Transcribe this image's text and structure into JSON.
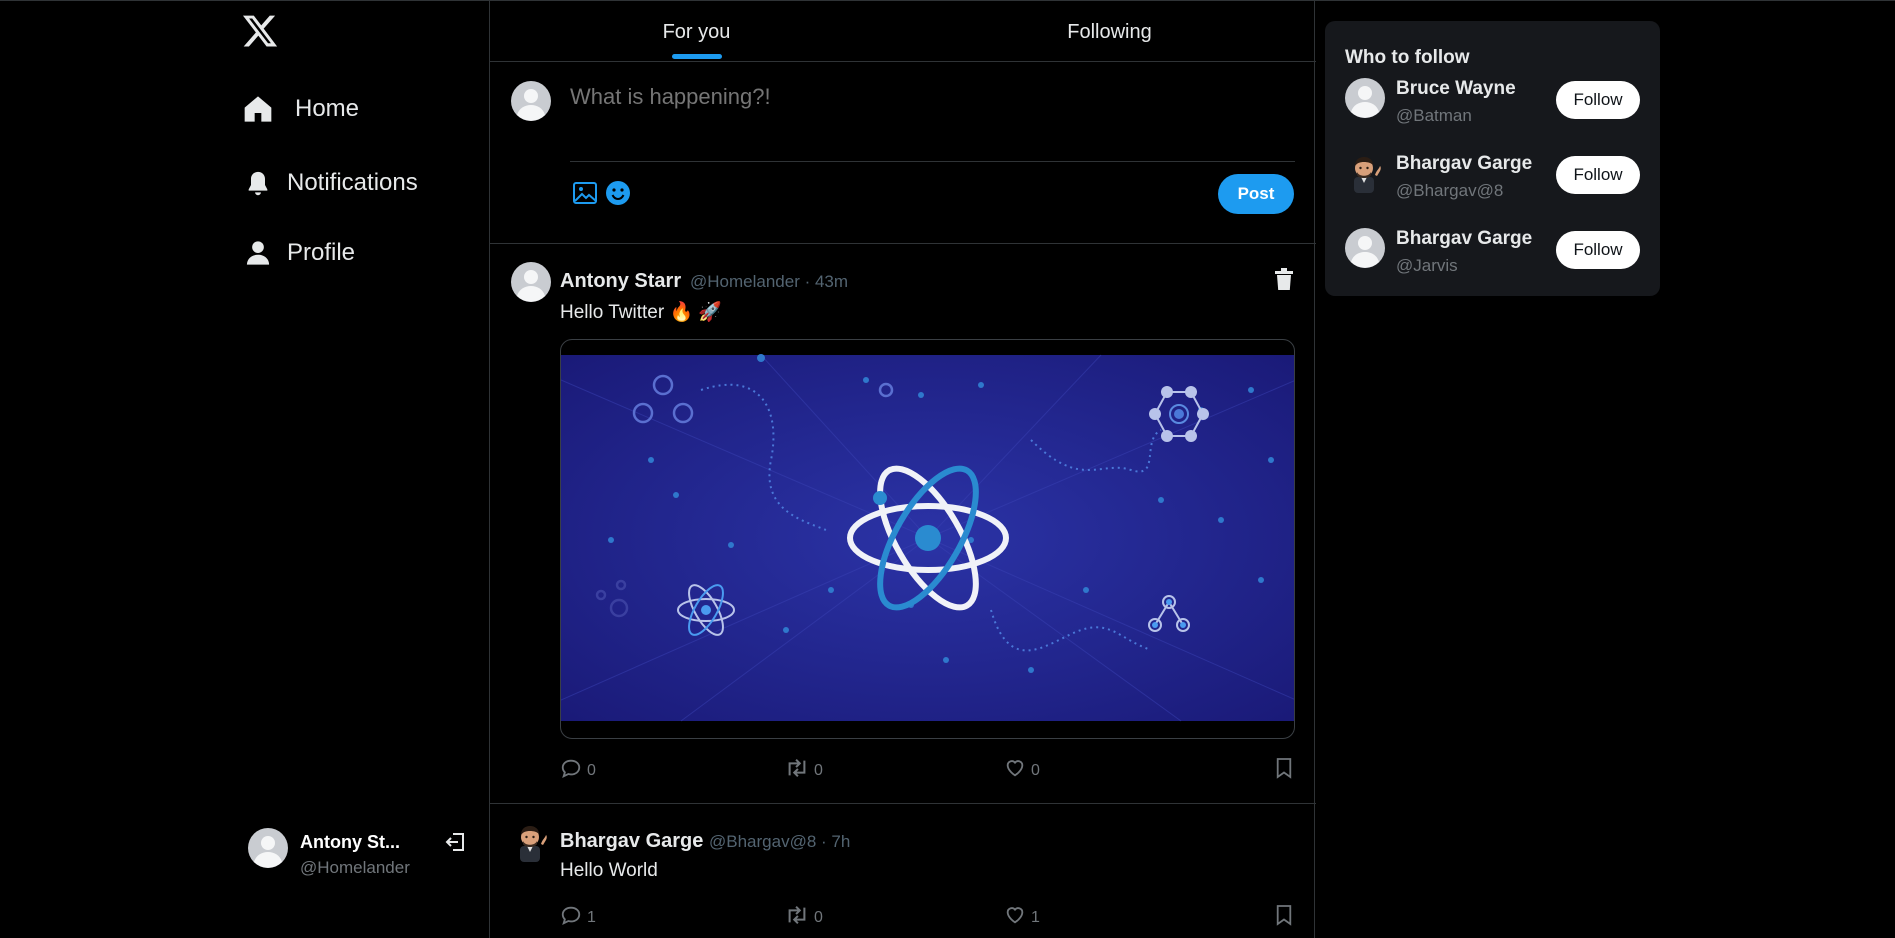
{
  "nav": {
    "items": [
      {
        "label": "Home",
        "icon": "home-icon"
      },
      {
        "label": "Notifications",
        "icon": "bell-icon"
      },
      {
        "label": "Profile",
        "icon": "person-icon"
      }
    ]
  },
  "account": {
    "name": "Antony St...",
    "handle": "@Homelander"
  },
  "tabs": [
    {
      "label": "For you",
      "active": true
    },
    {
      "label": "Following",
      "active": false
    }
  ],
  "composer": {
    "placeholder": "What is happening?!",
    "post_label": "Post"
  },
  "tweets": [
    {
      "author": "Antony Starr",
      "meta": "@Homelander · 43m",
      "text": "Hello Twitter 🔥 🚀",
      "replies": "0",
      "retweets": "0",
      "likes": "0",
      "media": "react-atom-illustration"
    },
    {
      "author": "Bhargav Garge",
      "meta": "@Bhargav@8 · 7h",
      "text": "Hello World",
      "replies": "1",
      "retweets": "0",
      "likes": "1"
    }
  ],
  "who_to_follow": {
    "title": "Who to follow",
    "users": [
      {
        "name": "Bruce Wayne",
        "handle": "@Batman",
        "button": "Follow"
      },
      {
        "name": "Bhargav Garge",
        "handle": "@Bhargav@8",
        "button": "Follow"
      },
      {
        "name": "Bhargav Garge",
        "handle": "@Jarvis",
        "button": "Follow"
      }
    ]
  },
  "colors": {
    "accent": "#1d9bf0",
    "background": "#000000",
    "panel": "#16181c",
    "muted": "#71767b"
  }
}
